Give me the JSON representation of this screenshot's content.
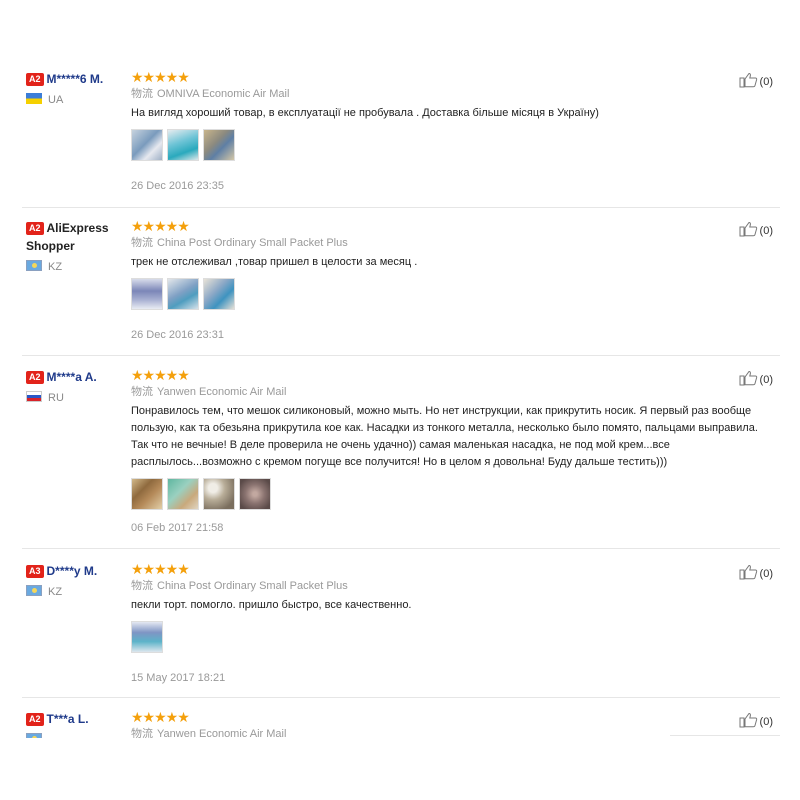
{
  "reviews": [
    {
      "badge": "A2",
      "name": "M*****6 M.",
      "country": "UA",
      "stars": "★★★★★",
      "logistics_label": "物流",
      "logistics": "OMNIVA Economic Air Mail",
      "comment": "На вигляд хороший товар, в експлуатації не пробувала . Доставка більше місяця в Україну)",
      "date": "26 Dec 2016 23:35",
      "helpful": "(0)"
    },
    {
      "badge": "A2",
      "name": "AliExpress Shopper",
      "country": "KZ",
      "stars": "★★★★★",
      "logistics_label": "物流",
      "logistics": "China Post Ordinary Small Packet Plus",
      "comment": "трек не отслеживал ,товар пришел в целости за месяц .",
      "date": "26 Dec 2016 23:31",
      "helpful": "(0)"
    },
    {
      "badge": "A2",
      "name": "M****a A.",
      "country": "RU",
      "stars": "★★★★★",
      "logistics_label": "物流",
      "logistics": "Yanwen Economic Air Mail",
      "comment": "Понравилось тем, что мешок силиконовый, можно мыть. Но нет инструкции, как прикрутить носик. Я первый раз вообще пользую, как та обезьяна прикрутила кое как. Насадки из тонкого металла, несколько было помято, пальцами выправила. Так что не вечные! В деле проверила не очень удачно)) самая маленькая насадка, не под мой крем...все расплылось...возможно с кремом погуще все получится! Но в целом я довольна! Буду дальше тестить)))",
      "date": "06 Feb 2017 21:58",
      "helpful": "(0)"
    },
    {
      "badge": "A3",
      "name": "D****y M.",
      "country": "KZ",
      "stars": "★★★★★",
      "logistics_label": "物流",
      "logistics": "China Post Ordinary Small Packet Plus",
      "comment": "пекли торт. помогло. пришло быстро, все качественно.",
      "date": "15 May 2017 18:21",
      "helpful": "(0)"
    },
    {
      "badge": "A2",
      "name": "T***a L.",
      "country": "",
      "stars": "★★★★★",
      "logistics_label": "物流",
      "logistics": "Yanwen Economic Air Mail",
      "comment": "",
      "date": "",
      "helpful": "(0)"
    }
  ]
}
